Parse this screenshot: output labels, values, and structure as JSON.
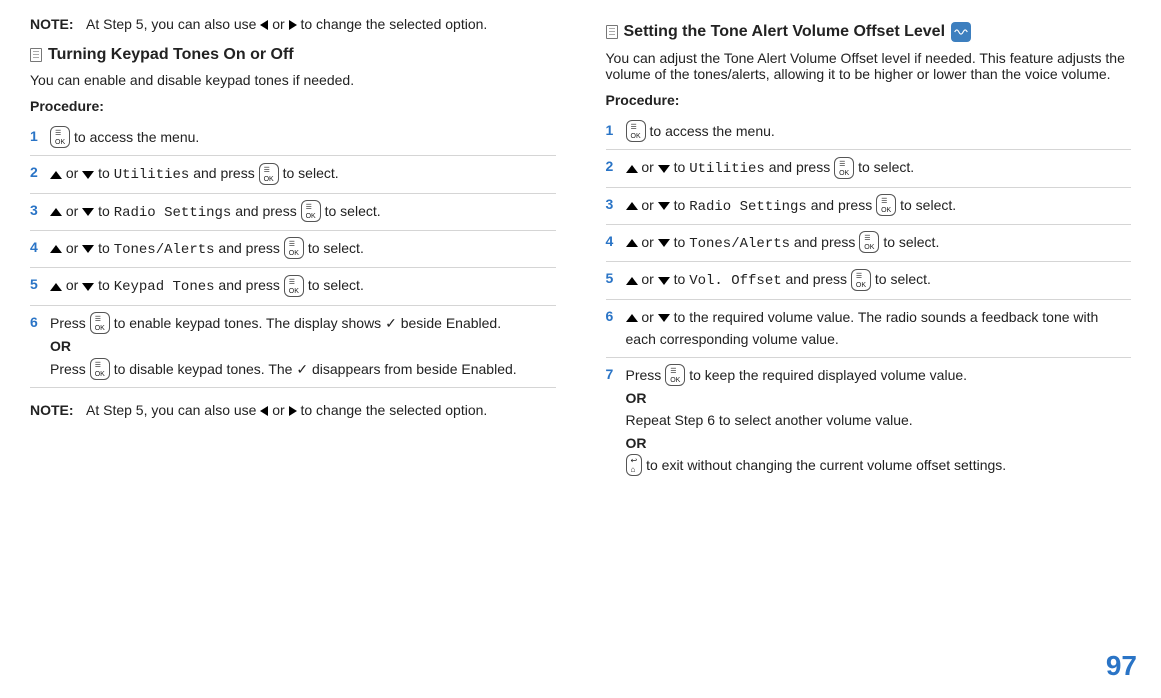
{
  "left": {
    "noteTop": {
      "label": "NOTE:",
      "text_a": "At Step 5, you can also use ",
      "text_b": " or ",
      "text_c": " to change the selected option."
    },
    "title": "Turning Keypad Tones On or Off",
    "intro": "You can enable and disable keypad tones if needed.",
    "procLabel": "Procedure:",
    "steps": {
      "s1": {
        "num": "1",
        "a": " to access the menu."
      },
      "s2": {
        "num": "2",
        "a": " or ",
        "b": " to ",
        "menu": "Utilities",
        "c": " and press ",
        "d": " to select."
      },
      "s3": {
        "num": "3",
        "a": " or ",
        "b": " to ",
        "menu": "Radio Settings",
        "c": " and press ",
        "d": " to select."
      },
      "s4": {
        "num": "4",
        "a": " or ",
        "b": " to ",
        "menu": "Tones/Alerts",
        "c": " and press ",
        "d": " to select."
      },
      "s5": {
        "num": "5",
        "a": " or ",
        "b": " to ",
        "menu": "Keypad Tones",
        "c": " and press ",
        "d": " to select."
      },
      "s6": {
        "num": "6",
        "a": "Press ",
        "b": " to enable keypad tones. The display shows ",
        "check": "✓",
        "c": " beside Enabled.",
        "or": "OR",
        "d": "Press ",
        "e": " to disable keypad tones. The ",
        "f": " disappears from beside Enabled."
      }
    },
    "noteBottom": {
      "label": "NOTE:",
      "text_a": "At Step 5, you can also use ",
      "text_b": " or ",
      "text_c": " to change the selected option."
    }
  },
  "right": {
    "title": "Setting the Tone Alert Volume Offset Level ",
    "intro": "You can adjust the Tone Alert Volume Offset level if needed. This feature adjusts the volume of the tones/alerts, allowing it to be higher or lower than the voice volume.",
    "procLabel": "Procedure:",
    "steps": {
      "s1": {
        "num": "1",
        "a": " to access the menu."
      },
      "s2": {
        "num": "2",
        "a": " or ",
        "b": " to ",
        "menu": "Utilities",
        "c": " and press ",
        "d": " to select."
      },
      "s3": {
        "num": "3",
        "a": " or ",
        "b": " to ",
        "menu": "Radio Settings",
        "c": " and press ",
        "d": " to select."
      },
      "s4": {
        "num": "4",
        "a": " or ",
        "b": " to ",
        "menu": "Tones/Alerts",
        "c": " and press ",
        "d": " to select."
      },
      "s5": {
        "num": "5",
        "a": " or ",
        "b": " to ",
        "menu": "Vol. Offset",
        "c": " and press ",
        "d": " to select."
      },
      "s6": {
        "num": "6",
        "a": " or ",
        "b": " to the required volume value. The radio sounds a feedback tone with each corresponding volume value."
      },
      "s7": {
        "num": "7",
        "a": "Press ",
        "b": " to keep the required displayed volume value.",
        "or1": "OR",
        "c": "Repeat Step 6 to select another volume value.",
        "or2": "OR",
        "d": " to exit without changing the current volume offset settings."
      }
    }
  },
  "pageNum": "97"
}
